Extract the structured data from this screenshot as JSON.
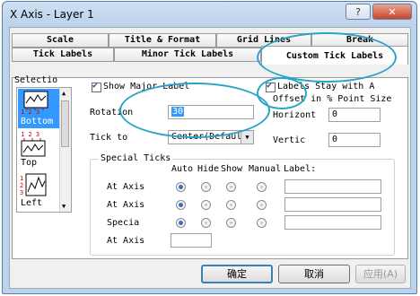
{
  "window": {
    "title": "X Axis - Layer 1",
    "help": "?",
    "close": "✕"
  },
  "tabs_row1": [
    "Scale",
    "Title & Format",
    "Grid Lines",
    "Break"
  ],
  "tabs_row2": [
    "Tick Labels",
    "Minor Tick Labels",
    "Custom Tick Labels"
  ],
  "selection": {
    "header": "Selectio",
    "items": [
      {
        "label": "Bottom",
        "selected": true,
        "digits": "1 2 3"
      },
      {
        "label": "Top",
        "selected": false,
        "digits": "1 2 3"
      },
      {
        "label": "Left",
        "selected": false,
        "digits": "1 2 3"
      }
    ]
  },
  "show_major_label": {
    "label": "Show Major Label",
    "checked": true
  },
  "rotation": {
    "label": "Rotation",
    "value": "30"
  },
  "tick_to": {
    "label": "Tick to",
    "value": "Center(Default"
  },
  "labels_stay": {
    "label": "Labels Stay with A",
    "checked": true
  },
  "offset": {
    "label": "Offset in % Point Size",
    "horizontal_label": "Horizont",
    "horizontal_value": "0",
    "vertical_label": "Vertic",
    "vertical_value": "0"
  },
  "special_ticks": {
    "title": "Special Ticks",
    "columns": [
      "Auto",
      "Hide",
      "Show",
      "Manual",
      "Label:"
    ],
    "rows": [
      {
        "label": "At Axis",
        "selected": "Auto"
      },
      {
        "label": "At Axis",
        "selected": "Auto"
      },
      {
        "label": "Specia",
        "selected": "Auto"
      }
    ],
    "last_row_label": "At Axis"
  },
  "buttons": {
    "ok": "确定",
    "cancel": "取消",
    "apply": "应用(A)"
  },
  "colors": {
    "highlight_circle": "#2ba3c9",
    "selected_item": "#3399ff"
  }
}
